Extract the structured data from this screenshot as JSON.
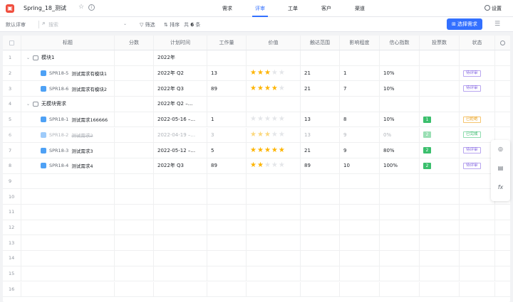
{
  "topbar": {
    "project_title": "Spring_18_测试",
    "tabs": [
      {
        "label": "需求",
        "active": false
      },
      {
        "label": "评审",
        "active": true
      },
      {
        "label": "工单",
        "active": false
      },
      {
        "label": "客户",
        "active": false
      },
      {
        "label": "渠道",
        "active": false
      }
    ],
    "settings_label": "设置"
  },
  "toolbar": {
    "view_label": "默认评审",
    "search_placeholder": "搜索",
    "filter_label": "筛选",
    "sort_label": "排序",
    "count_prefix": "共",
    "count_value": "6",
    "count_suffix": "条",
    "select_button_label": "选择需求"
  },
  "table": {
    "columns": [
      "标题",
      "分数",
      "计划时间",
      "工作量",
      "价值",
      "触达范围",
      "影响程度",
      "信心指数",
      "投票数",
      "状态"
    ],
    "rows": [
      {
        "num": "1",
        "kind": "group",
        "title": "模块1",
        "plan": "2022年"
      },
      {
        "num": "2",
        "kind": "item",
        "code": "SPR18-5",
        "title": "测试需求有模块1",
        "score": "",
        "plan": "2022年 Q2",
        "effort": "13",
        "value": 3,
        "reach": "21",
        "impact": "1",
        "confidence": "10%",
        "votes": "",
        "status": "待评审",
        "status_color": "purple",
        "dot": true,
        "dim": false
      },
      {
        "num": "3",
        "kind": "item",
        "code": "SPR18-6",
        "title": "测试需求有模块2",
        "score": "",
        "plan": "2022年 Q3",
        "effort": "89",
        "value": 4,
        "reach": "21",
        "impact": "7",
        "confidence": "10%",
        "votes": "",
        "status": "待评审",
        "status_color": "purple",
        "dot": true,
        "dim": false
      },
      {
        "num": "4",
        "kind": "group",
        "title": "无模块需求",
        "plan": "2022年 Q2 –..."
      },
      {
        "num": "5",
        "kind": "item",
        "code": "SPR18-1",
        "title": "测试需求166666",
        "score": "",
        "plan": "2022-05-16 –...",
        "effort": "1",
        "value": 0,
        "reach": "13",
        "impact": "8",
        "confidence": "10%",
        "votes": "1",
        "status": "已拒绝",
        "status_color": "orange",
        "dot": true,
        "dim": false
      },
      {
        "num": "6",
        "kind": "item",
        "code": "SPR18-2",
        "title": "测试需求2",
        "score": "",
        "plan": "2022-04-19 –...",
        "effort": "3",
        "value": 3,
        "reach": "13",
        "impact": "9",
        "confidence": "0%",
        "votes": "2",
        "status": "已完成",
        "status_color": "green",
        "dot": false,
        "dim": true
      },
      {
        "num": "7",
        "kind": "item",
        "code": "SPR18-3",
        "title": "测试需求3",
        "score": "",
        "plan": "2022-05-12 –...",
        "effort": "5",
        "value": 5,
        "reach": "21",
        "impact": "9",
        "confidence": "80%",
        "votes": "2",
        "status": "待评审",
        "status_color": "purple",
        "dot": false,
        "dim": false
      },
      {
        "num": "8",
        "kind": "item",
        "code": "SPR18-4",
        "title": "测试需求4",
        "score": "",
        "plan": "2022年 Q3",
        "effort": "89",
        "value": 2,
        "reach": "89",
        "impact": "10",
        "confidence": "100%",
        "votes": "2",
        "status": "待评审",
        "status_color": "purple",
        "dot": false,
        "dim": false
      },
      {
        "num": "9",
        "kind": "empty"
      },
      {
        "num": "10",
        "kind": "empty"
      },
      {
        "num": "11",
        "kind": "empty"
      },
      {
        "num": "12",
        "kind": "empty"
      },
      {
        "num": "13",
        "kind": "empty"
      },
      {
        "num": "14",
        "kind": "empty"
      },
      {
        "num": "15",
        "kind": "empty"
      },
      {
        "num": "16",
        "kind": "empty"
      }
    ]
  },
  "sidepanel": {
    "icons": [
      "target-icon",
      "document-icon",
      "formula-icon"
    ],
    "formula_label": "fx"
  }
}
